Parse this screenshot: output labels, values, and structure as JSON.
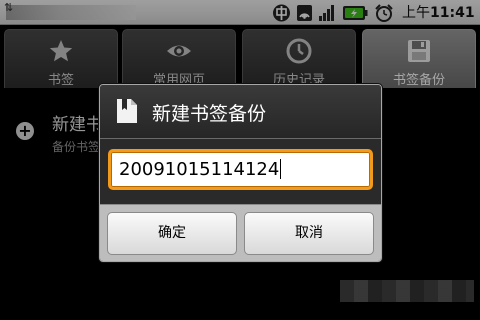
{
  "status_bar": {
    "time_prefix": "上午",
    "time": "11:41",
    "icons": [
      "usb-icon",
      "carrier-icon",
      "signal-icon",
      "network-icon",
      "battery-icon",
      "alarm-icon"
    ]
  },
  "tabs": [
    {
      "label": "书签",
      "icon": "star-icon"
    },
    {
      "label": "常用网页",
      "icon": "eye-icon"
    },
    {
      "label": "历史记录",
      "icon": "clock-icon"
    },
    {
      "label": "书签备份",
      "icon": "save-icon",
      "selected": true
    }
  ],
  "list": {
    "items": [
      {
        "title": "新建书签备份",
        "subtitle": "备份书签"
      }
    ]
  },
  "dialog": {
    "title": "新建书签备份",
    "input_value": "20091015114124",
    "ok_label": "确定",
    "cancel_label": "取消"
  },
  "colors": {
    "input_focus": "#f29a1b",
    "tab_selected": "#8a8a8a",
    "dialog_bg": "#2a2a2a"
  }
}
